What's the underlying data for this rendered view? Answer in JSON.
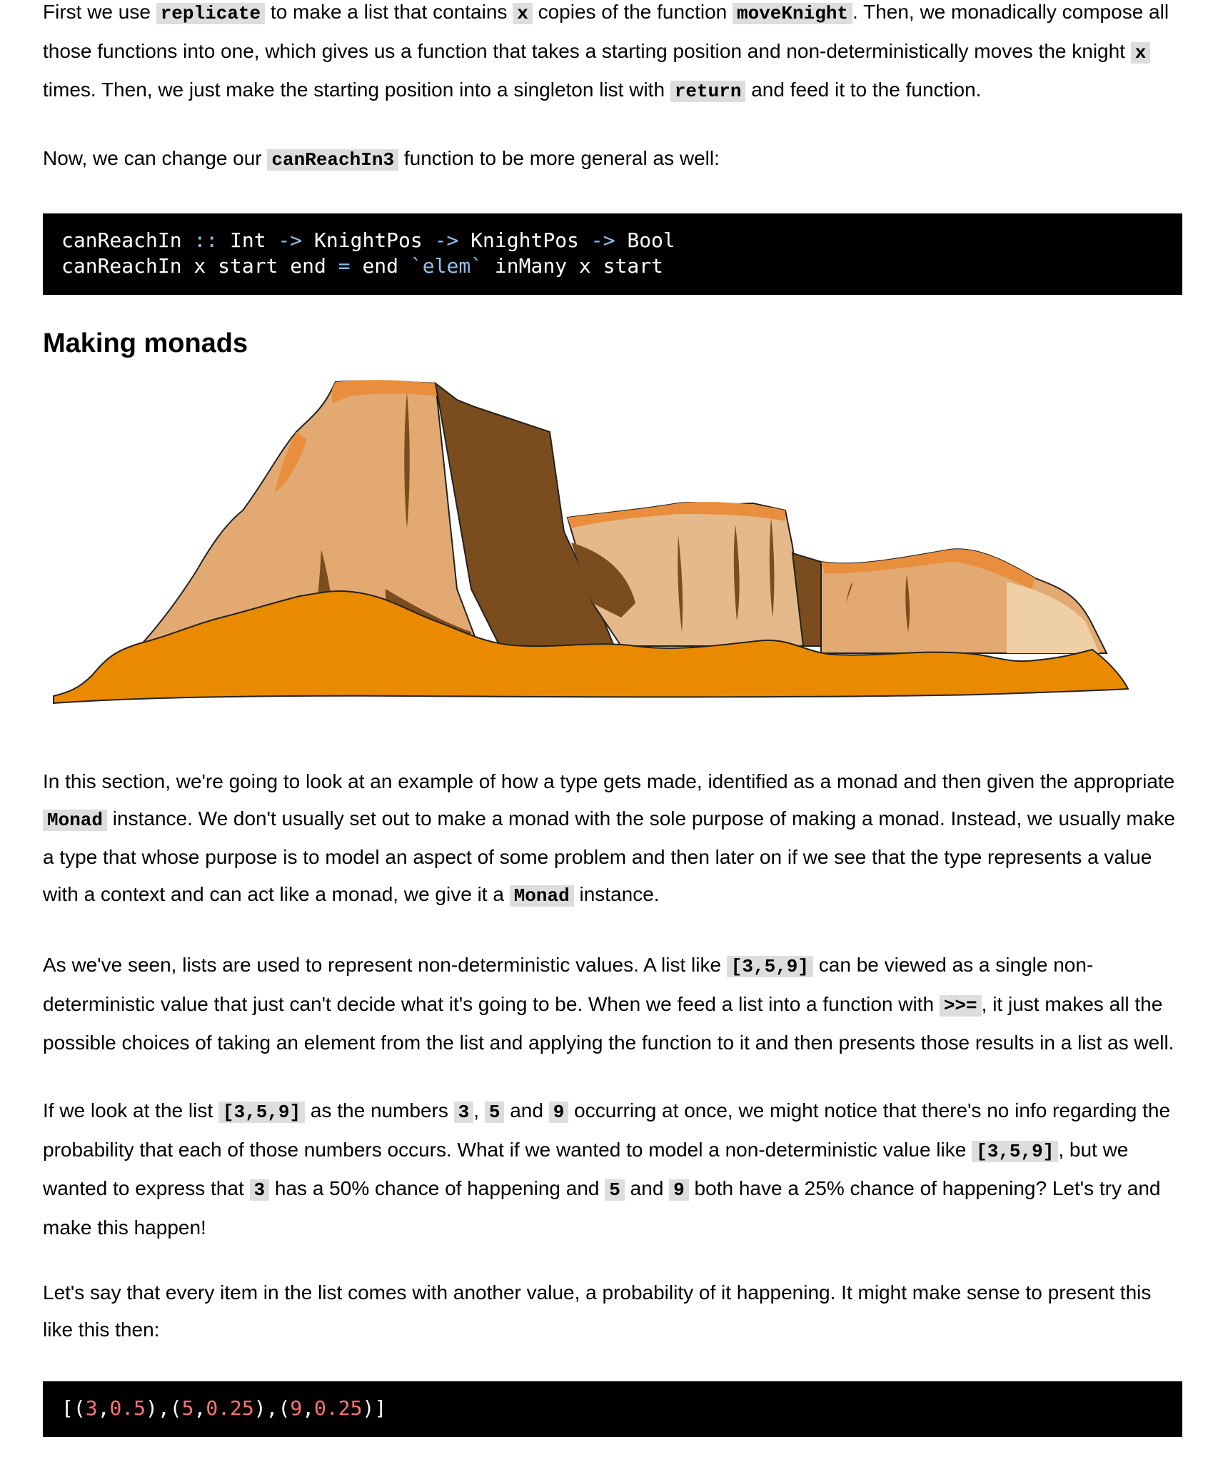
{
  "para1": {
    "t1": "First we use ",
    "c1": "replicate",
    "t2": " to make a list that contains ",
    "c2": "x",
    "t3": " copies of the function ",
    "c3": "moveKnight",
    "t4": ". Then, we monadically compose all those functions into one, which gives us a function that takes a starting position and non-deterministically moves the knight ",
    "c4": "x",
    "t5": " times. Then, we just make the starting position into a singleton list with ",
    "c5": "return",
    "t6": " and feed it to the function."
  },
  "para2": {
    "t1": "Now, we can change our ",
    "c1": "canReachIn3",
    "t2": " function to be more general as well:"
  },
  "code1": {
    "l1_a": "canReachIn ",
    "l1_op1": "::",
    "l1_b": " Int ",
    "l1_op2": "->",
    "l1_c": " KnightPos ",
    "l1_op3": "->",
    "l1_d": " KnightPos ",
    "l1_op4": "->",
    "l1_e": " Bool",
    "l2_a": "canReachIn x start end ",
    "l2_op1": "=",
    "l2_b": " end ",
    "l2_str": "`elem`",
    "l2_c": " inMany x start"
  },
  "heading": "Making monads",
  "para3": {
    "t1": "In this section, we're going to look at an example of how a type gets made, identified as a monad and then given the appropriate ",
    "c1": "Monad",
    "t2": " instance. We don't usually set out to make a monad with the sole purpose of making a monad. Instead, we usually make a type that whose purpose is to model an aspect of some problem and then later on if we see that the type represents a value with a context and can act like a monad, we give it a ",
    "c2": "Monad",
    "t3": " instance."
  },
  "para4": {
    "t1": "As we've seen, lists are used to represent non-deterministic values. A list like ",
    "c1": "[3,5,9]",
    "t2": " can be viewed as a single non-deterministic value that just can't decide what it's going to be. When we feed a list into a function with ",
    "c2": ">>=",
    "t3": ", it just makes all the possible choices of taking an element from the list and applying the function to it and then presents those results in a list as well."
  },
  "para5": {
    "t1": "If we look at the list ",
    "c1": "[3,5,9]",
    "t2": " as the numbers ",
    "c2": "3",
    "t3": ", ",
    "c3": "5",
    "t4": " and ",
    "c4": "9",
    "t5": " occurring at once, we might notice that there's no info regarding the probability that each of those numbers occurs. What if we wanted to model a non-deterministic value like ",
    "c5": "[3,5,9]",
    "t6": ", but we wanted to express that ",
    "c6": "3",
    "t7": " has a 50% chance of happening and ",
    "c7": "5",
    "t8": " and ",
    "c8": "9",
    "t9": " both have a 25% chance of happening? Let's try and make this happen!"
  },
  "para6": {
    "t1": "Let's say that every item in the list comes with another value, a probability of it happening. It might make sense to present this like this then:"
  },
  "code2": {
    "p1": "[(",
    "n1": "3",
    "p2": ",",
    "n2": "0.5",
    "p3": "),(",
    "n3": "5",
    "p4": ",",
    "n4": "0.25",
    "p5": "),(",
    "n5": "9",
    "p6": ",",
    "n6": "0.25",
    "p7": ")]"
  },
  "colors": {
    "code_bg": "#000000",
    "inline_code_bg": "#dddddd",
    "keyword": "#8fc0ee",
    "number": "#ff7373",
    "rock_light": "#e2aa72",
    "rock_dark": "#7b4c1d",
    "sand": "#ea8a00"
  }
}
